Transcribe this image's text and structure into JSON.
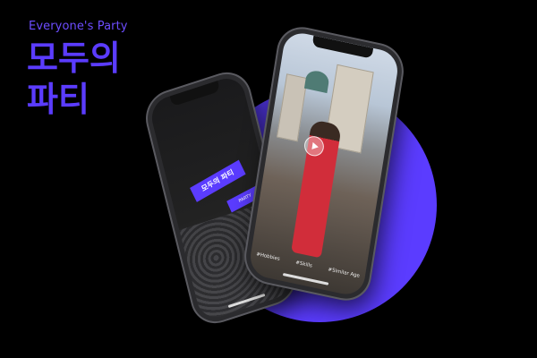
{
  "header": {
    "subtitle": "Everyone's Party",
    "title_line1": "모두의",
    "title_line2": "파티"
  },
  "phone_left": {
    "banner_text": "모두의 파티",
    "banner_small": "PARTY"
  },
  "phone_right": {
    "tags": [
      "#Hobbies",
      "#Skills",
      "#Similar Age"
    ]
  },
  "colors": {
    "accent": "#5b3cff",
    "background": "#000000"
  }
}
